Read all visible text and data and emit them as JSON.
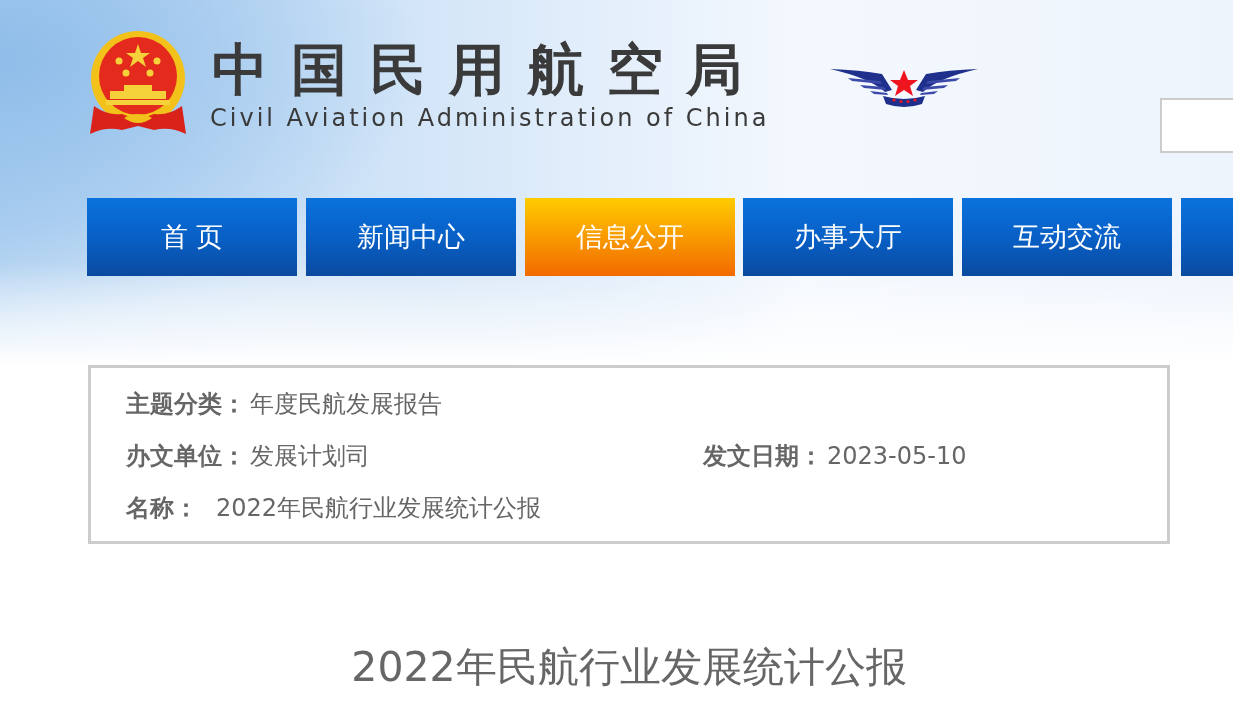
{
  "header": {
    "title": "中国民用航空局",
    "subtitle": "Civil Aviation Administration of China"
  },
  "nav": [
    {
      "label": "首 页",
      "selected": false
    },
    {
      "label": "新闻中心",
      "selected": false
    },
    {
      "label": "信息公开",
      "selected": true
    },
    {
      "label": "办事大厅",
      "selected": false
    },
    {
      "label": "互动交流",
      "selected": false
    },
    {
      "selected": false
    }
  ],
  "info": {
    "rows": [
      [
        {
          "label": "主题分类：",
          "value": "年度民航发展报告"
        }
      ],
      [
        {
          "label": "办文单位：",
          "value": "发展计划司"
        },
        {
          "label": "发文日期：",
          "value": "2023-05-10"
        }
      ],
      [
        {
          "label": "名称：",
          "value": "2022年民航行业发展统计公报"
        }
      ]
    ]
  },
  "article": {
    "title": "2022年民航行业发展统计公报"
  }
}
